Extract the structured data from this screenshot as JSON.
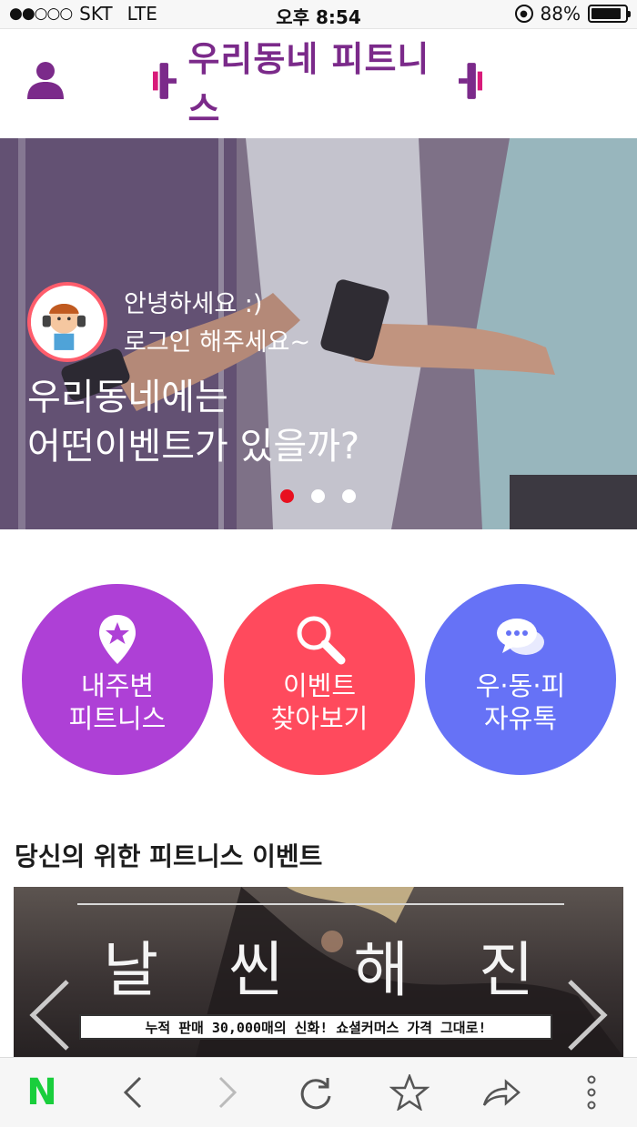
{
  "status_bar": {
    "carrier": "SKT",
    "network": "LTE",
    "signal": "●●○○○",
    "time": "오후 8:54",
    "battery_text": "88%",
    "battery_level": 0.88
  },
  "header": {
    "logo_text": "우리동네 피트니스",
    "profile_icon": "person-icon",
    "brand_color": "#7b2a8a"
  },
  "hero": {
    "greeting_line1": "안녕하세요 :)",
    "greeting_line2": "로그인 해주세요~",
    "title_line1": "우리동네에는",
    "title_line2": "어떤이벤트가 있을까?",
    "slides": 3,
    "active_slide": 1,
    "active_dot_color": "#e8101f"
  },
  "quick_menu": [
    {
      "line1": "내주변",
      "line2": "피트니스",
      "icon": "map-pin-star-icon",
      "color": "#ae40d6"
    },
    {
      "line1": "이벤트",
      "line2": "찾아보기",
      "icon": "magnifier-icon",
      "color": "#ff4a5d"
    },
    {
      "line1": "우·동·피",
      "line2": "자유톡",
      "icon": "chat-bubbles-icon",
      "color": "#6672f6"
    }
  ],
  "events_section": {
    "title": "당신의 위한 피트니스 이벤트",
    "banner": {
      "headline_chars": [
        "날",
        "씬",
        "해",
        "진"
      ],
      "strip_text": "누적 판매 30,000매의 신화! 쇼셜커머스 가격 그대로!"
    }
  },
  "browser_toolbar": {
    "items": [
      "naver-n-icon",
      "back-icon",
      "forward-icon",
      "reload-icon",
      "bookmark-star-icon",
      "share-icon",
      "more-icon"
    ],
    "naver_letter": "N",
    "naver_color": "#19ce3c"
  }
}
